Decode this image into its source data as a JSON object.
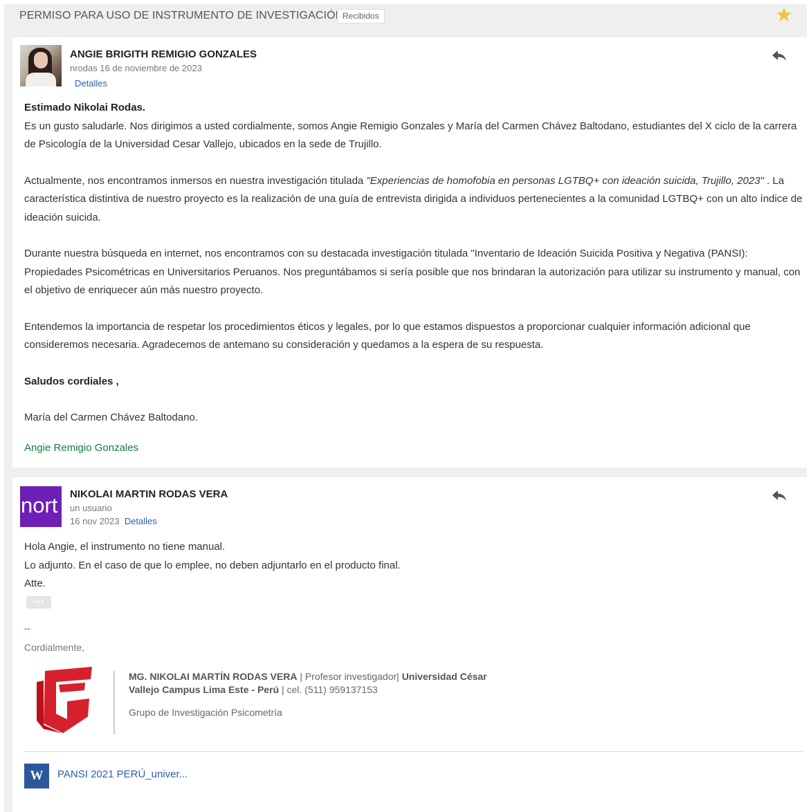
{
  "subject_bar": {
    "subject": "PERMISO PARA USO DE INSTRUMENTO DE INVESTIGACIÓN",
    "label": "Recibidos",
    "star_icon": "star-icon"
  },
  "message1": {
    "sender": "ANGIE BRIGITH REMIGIO GONZALES",
    "recipient_line": "nrodas 16 de noviembre de 2023",
    "details_link": "Detalles",
    "greeting": "Estimado Nikolai Rodas.",
    "para1": "Es un gusto saludarle. Nos dirigimos a usted cordialmente, somos Angie Remigio Gonzales y María del Carmen Chávez Baltodano, estudiantes del X ciclo de la carrera de Psicología de la Universidad Cesar Vallejo, ubicados en la sede de Trujillo.",
    "para2_pre": "Actualmente, nos encontramos inmersos en nuestra investigación titulada ",
    "para2_title": "\"Experiencias de homofobia en personas LGTBQ+ con ideación suicida, Trujillo, 2023\"",
    "para2_post": " . La característica distintiva de nuestro proyecto es la realización de una guía de entrevista dirigida a individuos pertenecientes a la comunidad LGTBQ+ con un alto índice de ideación suicida.",
    "para3": "Durante nuestra búsqueda en internet, nos encontramos con su destacada investigación titulada \"Inventario de Ideación Suicida Positiva y Negativa (PANSI): Propiedades Psicométricas en Universitarios Peruanos. Nos preguntábamos si sería posible que nos brindaran la autorización para utilizar su instrumento y manual, con el objetivo de enriquecer aún más nuestro proyecto.",
    "para4": "Entendemos la importancia de respetar los procedimientos éticos y legales, por lo que estamos dispuestos a proporcionar cualquier información adicional que consideremos necesaria. Agradecemos de antemano su consideración y quedamos a la espera de su respuesta.",
    "closing": "Saludos cordiales ,",
    "signer1": "María del Carmen Chávez Baltodano.",
    "signer2": "Angie Remigio Gonzales"
  },
  "message2": {
    "avatar_text": "nort",
    "sender": "NIKOLAI MARTIN RODAS VERA",
    "recipient_line": "un usuario",
    "date": "16 nov 2023",
    "details_link": "Detalles",
    "line1": "Hola Angie, el instrumento no tiene manual.",
    "line2": "Lo adjunto. En el caso de que lo emplee, no deben adjuntarlo en el producto final.",
    "line3": "Atte.",
    "ellipsis": "•••",
    "dash": "--",
    "cordialmente": "Cordialmente,",
    "sig_name": "MG. NIKOLAI MARTÍN RODAS VERA",
    "sig_role": "| Profesor investigador|",
    "sig_univ": "Universidad César",
    "sig_campus": "Vallejo Campus Lima Este - Perú",
    "sig_phone": "| cel. (511) 959137153",
    "sig_group": "Grupo de Investigación Psicometría",
    "attachment_icon": "W",
    "attachment_name": "PANSI 2021 PERÚ_univer..."
  },
  "colors": {
    "star": "#f4c430",
    "avatar_purple": "#6d1fb6",
    "link_blue": "#2a5fa8",
    "signature_green": "#1a7a3a",
    "logo_red": "#d6202c",
    "word_blue": "#2b579a"
  }
}
